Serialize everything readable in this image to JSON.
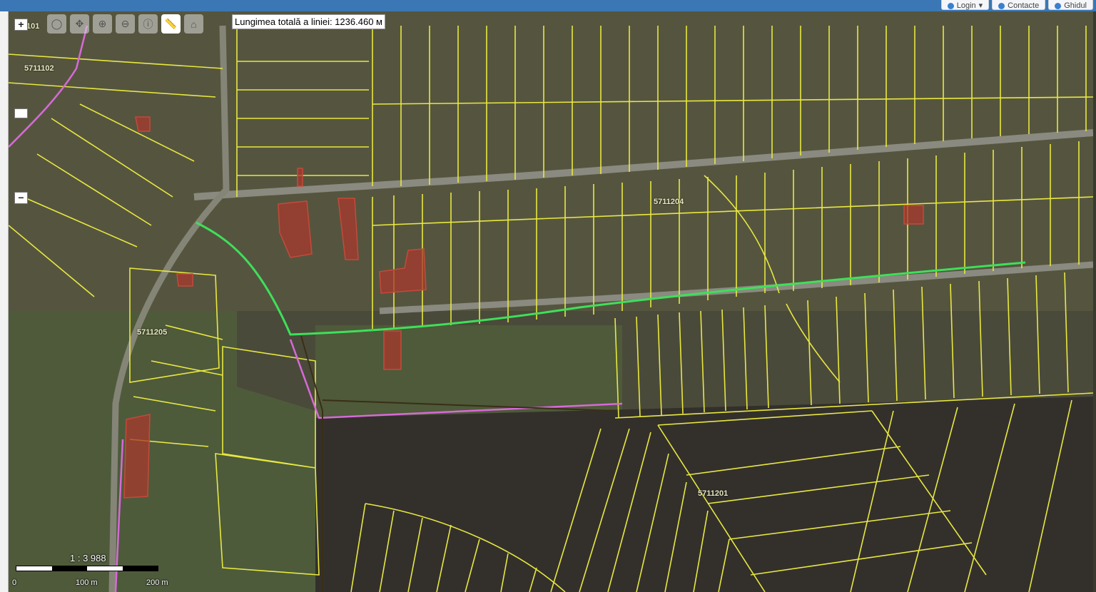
{
  "header": {
    "login_label": "Login",
    "contacts_label": "Contacte",
    "guide_label": "Ghidul"
  },
  "measure": {
    "text": "Lungimea totală a liniei: 1236.460 м"
  },
  "zoom": {
    "in_label": "+",
    "minus_label": "−"
  },
  "scale": {
    "ratio": "1 : 3 988",
    "tick0": "0",
    "tick1": "100 m",
    "tick2": "200 m"
  },
  "parcels": {
    "id1": "5711102",
    "id2": "5711205",
    "id3": "5711204",
    "id4": "5711201",
    "id5": "101"
  },
  "colors": {
    "parcel_line": "#e8e840",
    "selected_fill": "#a8382e",
    "measure_line": "#3ee05a",
    "boundary": "#d76ad8",
    "topbar": "#3b77b4"
  },
  "icons": [
    "pan-icon",
    "zoom-box-icon",
    "zoom-out-icon",
    "info-icon",
    "measure-icon",
    "home-icon"
  ]
}
